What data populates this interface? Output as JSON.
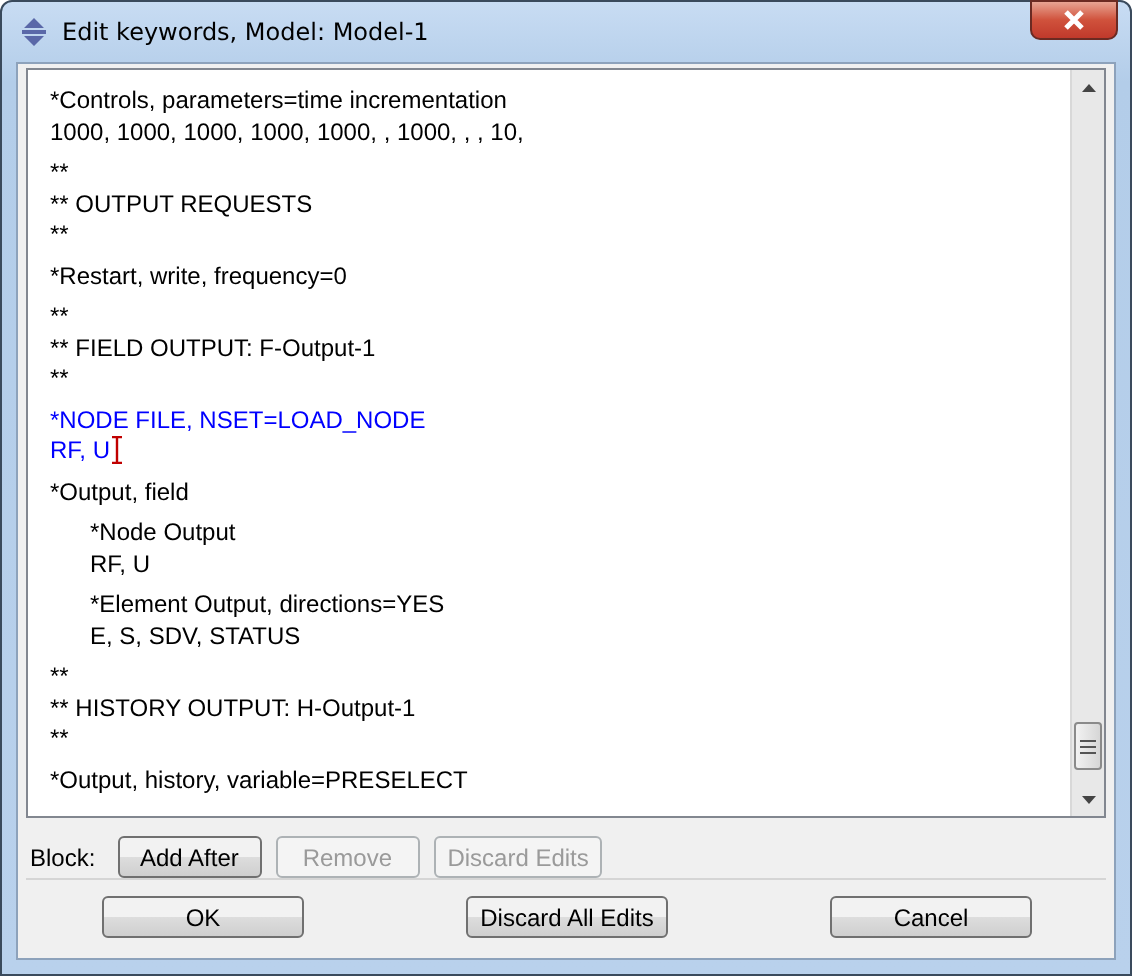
{
  "window": {
    "title": "Edit keywords, Model: Model-1"
  },
  "editor": {
    "blocks": [
      {
        "lines": [
          "*Controls, parameters=time incrementation",
          "1000, 1000, 1000, 1000, 1000, , 1000, , , 10,"
        ],
        "edited": false,
        "cursor": false
      },
      {
        "lines": [
          "**",
          "** OUTPUT REQUESTS",
          "**"
        ],
        "edited": false,
        "cursor": false
      },
      {
        "lines": [
          "*Restart, write, frequency=0"
        ],
        "edited": false,
        "cursor": false
      },
      {
        "lines": [
          "**",
          "** FIELD OUTPUT: F-Output-1",
          "**"
        ],
        "edited": false,
        "cursor": false
      },
      {
        "lines": [
          "*NODE FILE, NSET=LOAD_NODE",
          "RF, U"
        ],
        "edited": true,
        "cursor": true
      },
      {
        "lines": [
          "*Output, field"
        ],
        "edited": false,
        "cursor": false,
        "children": [
          {
            "lines": [
              "*Node Output",
              "RF, U"
            ],
            "edited": false,
            "cursor": false
          },
          {
            "lines": [
              "*Element Output, directions=YES",
              "E, S, SDV, STATUS"
            ],
            "edited": false,
            "cursor": false
          }
        ]
      },
      {
        "lines": [
          "**",
          "** HISTORY OUTPUT: H-Output-1",
          "**"
        ],
        "edited": false,
        "cursor": false
      },
      {
        "lines": [
          "*Output, history, variable=PRESELECT"
        ],
        "edited": false,
        "cursor": false
      }
    ]
  },
  "block_bar": {
    "label": "Block:",
    "buttons": [
      {
        "label": "Add After",
        "disabled": false
      },
      {
        "label": "Remove",
        "disabled": true
      },
      {
        "label": "Discard Edits",
        "disabled": true
      }
    ]
  },
  "buttons": [
    "OK",
    "Discard All Edits",
    "Cancel"
  ]
}
